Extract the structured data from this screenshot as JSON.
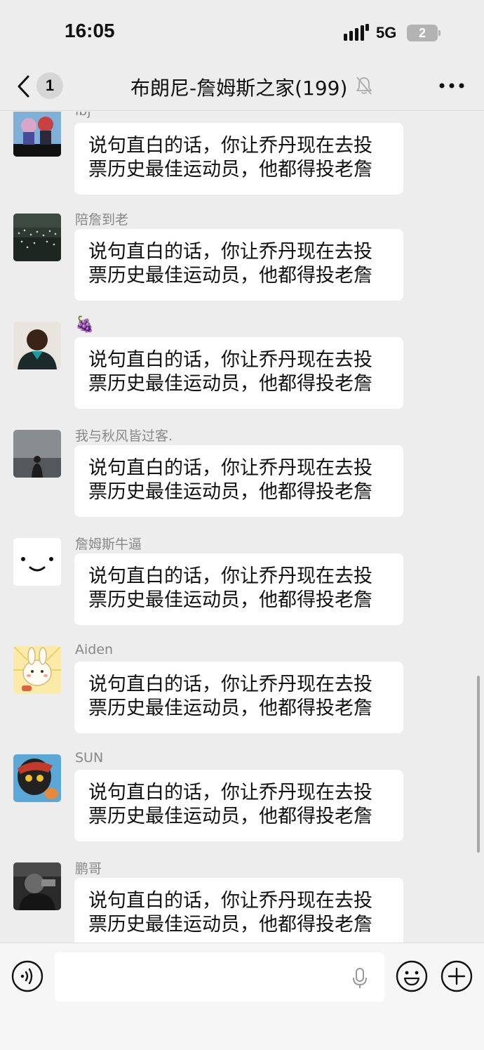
{
  "status_bar": {
    "time": "16:05",
    "network": "5G",
    "battery": "2"
  },
  "nav": {
    "unread_count": "1",
    "title": "布朗尼-詹姆斯之家(199)",
    "icons": [
      "back-icon",
      "mute-bell-icon",
      "more-icon"
    ]
  },
  "messages": [
    {
      "sender": "lbj",
      "avatar": "cartoon-characters-avatar",
      "text": "说句直白的话，你让乔丹现在去投票历史最佳运动员，他都得投老詹"
    },
    {
      "sender": "陪詹到老",
      "avatar": "stadium-lights-avatar",
      "text": "说句直白的话，你让乔丹现在去投票历史最佳运动员，他都得投老詹"
    },
    {
      "sender": "🍇",
      "avatar": "child-photo-avatar",
      "text": "说句直白的话，你让乔丹现在去投票历史最佳运动员，他都得投老詹"
    },
    {
      "sender": "我与秋风皆过客.",
      "avatar": "foggy-silhouette-avatar",
      "text": "说句直白的话，你让乔丹现在去投票历史最佳运动员，他都得投老詹"
    },
    {
      "sender": "詹姆斯牛逼",
      "avatar": "smiley-face-avatar",
      "text": "说句直白的话，你让乔丹现在去投票历史最佳运动员，他都得投老詹"
    },
    {
      "sender": "Aiden",
      "avatar": "cartoon-bunny-avatar",
      "text": "说句直白的话，你让乔丹现在去投票历史最佳运动员，他都得投老詹"
    },
    {
      "sender": "SUN",
      "avatar": "cartoon-character-avatar",
      "text": "说句直白的话，你让乔丹现在去投票历史最佳运动员，他都得投老詹"
    },
    {
      "sender": "鹏哥",
      "avatar": "dark-photo-avatar",
      "text": "说句直白的话，你让乔丹现在去投票历史最佳运动员，他都得投老詹"
    }
  ],
  "input_bar": {
    "placeholder": "",
    "icons": [
      "voice-icon",
      "mic-icon",
      "emoji-icon",
      "plus-icon"
    ]
  },
  "colors": {
    "background": "#ededed",
    "bubble": "#ffffff",
    "sender_text": "#888888",
    "badge": "#d6d6d6"
  }
}
